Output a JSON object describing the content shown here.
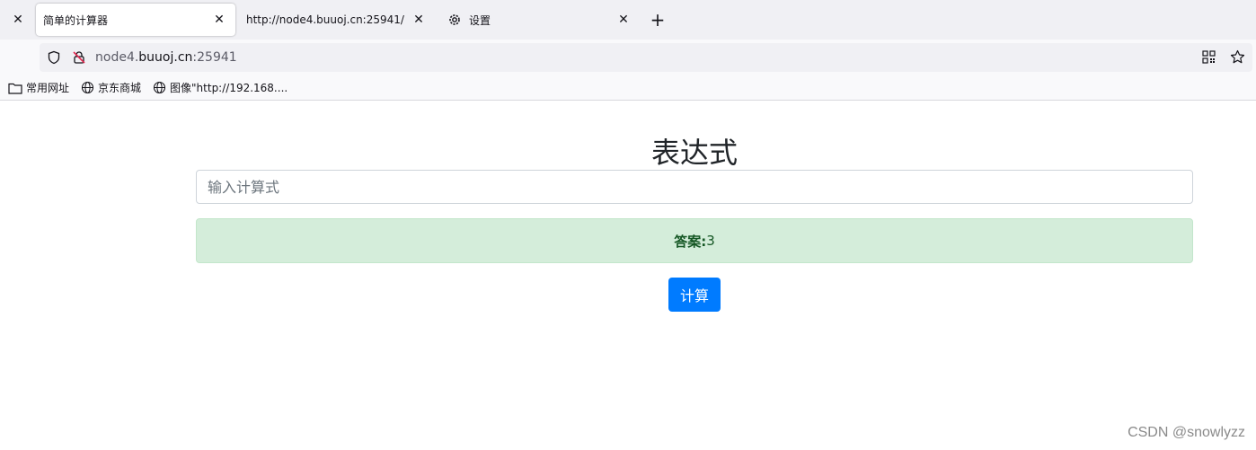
{
  "browser": {
    "tabs": [
      {
        "title": "简单的计算器",
        "active": true
      },
      {
        "title": "http://node4.buuoj.cn:25941/",
        "active": false
      },
      {
        "title": "设置",
        "active": false,
        "icon": "gear-icon"
      }
    ],
    "url": {
      "prefix": "node4.",
      "host": "buuoj.cn",
      "suffix": ":25941"
    },
    "bookmarks": [
      {
        "label": "常用网址",
        "icon": "folder-icon"
      },
      {
        "label": "京东商城",
        "icon": "globe-icon"
      },
      {
        "label": "图像\"http://192.168....",
        "icon": "globe-icon"
      }
    ]
  },
  "page": {
    "heading": "表达式",
    "input": {
      "placeholder": "输入计算式",
      "value": ""
    },
    "answer": {
      "label": "答案:",
      "value": "3"
    },
    "button_label": "计算"
  },
  "watermark": "CSDN @snowlyzz"
}
